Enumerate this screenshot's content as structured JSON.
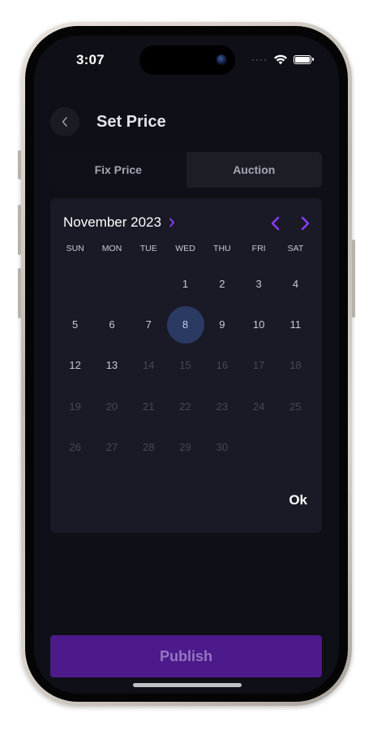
{
  "status_bar": {
    "time": "3:07"
  },
  "header": {
    "title": "Set Price"
  },
  "tabs": [
    {
      "label": "Fix Price",
      "active": true
    },
    {
      "label": "Auction",
      "active": false
    }
  ],
  "calendar": {
    "month_label": "November 2023",
    "weekdays": [
      "SUN",
      "MON",
      "TUE",
      "WED",
      "THU",
      "FRI",
      "SAT"
    ],
    "selected_day": "8",
    "weeks": [
      [
        null,
        null,
        null,
        {
          "d": "1",
          "enabled": true
        },
        {
          "d": "2",
          "enabled": true
        },
        {
          "d": "3",
          "enabled": true
        },
        {
          "d": "4",
          "enabled": true
        }
      ],
      [
        {
          "d": "5",
          "enabled": true
        },
        {
          "d": "6",
          "enabled": true
        },
        {
          "d": "7",
          "enabled": true
        },
        {
          "d": "8",
          "enabled": true
        },
        {
          "d": "9",
          "enabled": true
        },
        {
          "d": "10",
          "enabled": true
        },
        {
          "d": "11",
          "enabled": true
        }
      ],
      [
        {
          "d": "12",
          "enabled": true
        },
        {
          "d": "13",
          "enabled": true
        },
        {
          "d": "14",
          "enabled": false
        },
        {
          "d": "15",
          "enabled": false
        },
        {
          "d": "16",
          "enabled": false
        },
        {
          "d": "17",
          "enabled": false
        },
        {
          "d": "18",
          "enabled": false
        }
      ],
      [
        {
          "d": "19",
          "enabled": false
        },
        {
          "d": "20",
          "enabled": false
        },
        {
          "d": "21",
          "enabled": false
        },
        {
          "d": "22",
          "enabled": false
        },
        {
          "d": "23",
          "enabled": false
        },
        {
          "d": "24",
          "enabled": false
        },
        {
          "d": "25",
          "enabled": false
        }
      ],
      [
        {
          "d": "26",
          "enabled": false
        },
        {
          "d": "27",
          "enabled": false
        },
        {
          "d": "28",
          "enabled": false
        },
        {
          "d": "29",
          "enabled": false
        },
        {
          "d": "30",
          "enabled": false
        },
        null,
        null
      ]
    ],
    "ok_label": "Ok"
  },
  "publish_label": "Publish",
  "icons": {
    "back": "chevron-left-icon",
    "month_expand": "chevron-right-icon",
    "prev_month": "chevron-left-icon",
    "next_month": "chevron-right-icon"
  },
  "colors": {
    "background": "#0f0f17",
    "accent": "#8b3dff",
    "publish_bg": "#4c1a8a",
    "selected_day": "#2a3a63"
  }
}
